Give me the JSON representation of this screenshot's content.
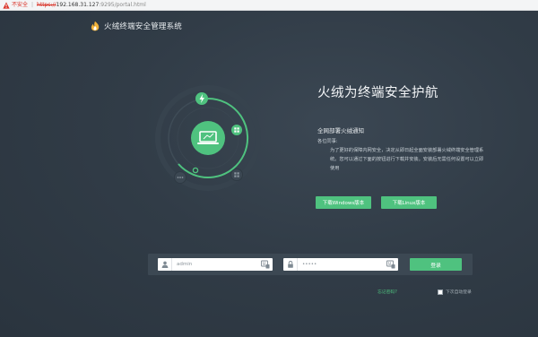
{
  "browser": {
    "insecure_label": "不安全",
    "separator": "|",
    "url_scheme": "https://",
    "url_host": "192.168.31.127",
    "url_path": ":9295/portal.html"
  },
  "brand": {
    "title": "火绒终端安全管理系统"
  },
  "hero": {
    "headline": "火绒为终端安全护航"
  },
  "notice": {
    "title": "全网部署火绒通知",
    "greeting": "各位同事:",
    "body": "为了更好的保障内网安全，决定从即日起全面安装部署火绒终端安全管理系统。您可以通过下面的按钮进行下载并安装。安装后无需任何设置可以立即使用"
  },
  "downloads": {
    "windows_label": "下载Windows版本",
    "linux_label": "下载Linux版本"
  },
  "login": {
    "username_value": "admin",
    "password_value": "•••••",
    "submit_label": "登录",
    "forgot_label": "忘记密码?",
    "remember_label": "下次自动登录"
  },
  "colors": {
    "accent": "#4fc27f",
    "background": "#2f3a44",
    "login_bar": "#3c4853"
  },
  "icons": {
    "brand": "fire-logo-icon",
    "lightning": "lightning-icon",
    "laptop": "laptop-icon",
    "grid": "grid-icon",
    "more": "more-dots-icon",
    "user": "user-icon",
    "lock": "lock-icon",
    "keyboard": "keyboard-icon"
  }
}
